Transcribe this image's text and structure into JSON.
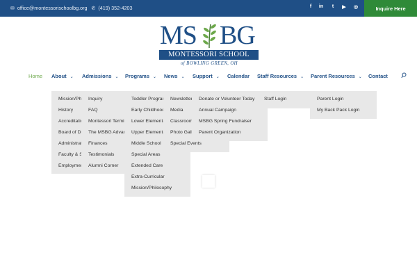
{
  "topbar": {
    "email": "office@montessorischoolbg.org",
    "phone": "(419) 352-4203",
    "social": [
      {
        "icon": "facebook-icon",
        "glyph": "f"
      },
      {
        "icon": "linkedin-icon",
        "glyph": "in"
      },
      {
        "icon": "twitter-icon",
        "glyph": "t"
      },
      {
        "icon": "youtube-icon",
        "glyph": "▶"
      },
      {
        "icon": "instagram-icon",
        "glyph": "◎"
      }
    ],
    "cta": "Inquire Here"
  },
  "logo": {
    "left": "MS",
    "right": "BG",
    "band": "MONTESSORI SCHOOL",
    "tagline": "of BOWLING GREEN, OH"
  },
  "nav": {
    "items": [
      {
        "label": "Home",
        "active": true
      },
      {
        "label": "About",
        "chevron": true
      },
      {
        "label": "Admissions",
        "chevron": true
      },
      {
        "label": "Programs",
        "chevron": true
      },
      {
        "label": "News",
        "chevron": true
      },
      {
        "label": "Support",
        "chevron": true
      },
      {
        "label": "Calendar"
      },
      {
        "label": "Staff Resources",
        "chevron": true
      },
      {
        "label": "Parent Resources",
        "chevron": true
      },
      {
        "label": "Contact"
      }
    ],
    "search_icon": "search-icon"
  },
  "dropdowns": [
    {
      "name": "about",
      "items": [
        "Mission/Philosophy",
        "History",
        "Accreditation",
        "Board of Directors",
        "Administration",
        "Faculty & Staff",
        "Employment"
      ]
    },
    {
      "name": "admissions",
      "items": [
        "Inquiry",
        "FAQ",
        "Montessori Terminology",
        "The MSBG Advantage",
        "Finances",
        "Testimonials",
        "Alumni Corner"
      ]
    },
    {
      "name": "programs",
      "items": [
        "Toddler Program",
        "Early Childhood",
        "Lower Elementary",
        "Upper Elementary",
        "Middle School",
        "Special Areas",
        "Extended Care",
        "Extra-Curricular",
        "Mission/Philosophy"
      ]
    },
    {
      "name": "news",
      "items": [
        "Newsletter",
        "Media",
        "Classrooms",
        "Photo Gallery",
        "Special Events"
      ]
    },
    {
      "name": "support",
      "items": [
        "Donate or Volunteer Today",
        "Annual Campaign",
        "MSBG Spring Fundraiser",
        "Parent Organization"
      ]
    },
    {
      "name": "staff",
      "items": [
        "Staff Login"
      ]
    },
    {
      "name": "parent",
      "items": [
        "Parent Login",
        "My Back Pack Login"
      ]
    }
  ],
  "colors": {
    "brand_blue": "#1f4f86",
    "accent_green": "#2f8a38",
    "active_nav": "#6ca84a",
    "dropdown_bg": "#e8e8e8"
  }
}
